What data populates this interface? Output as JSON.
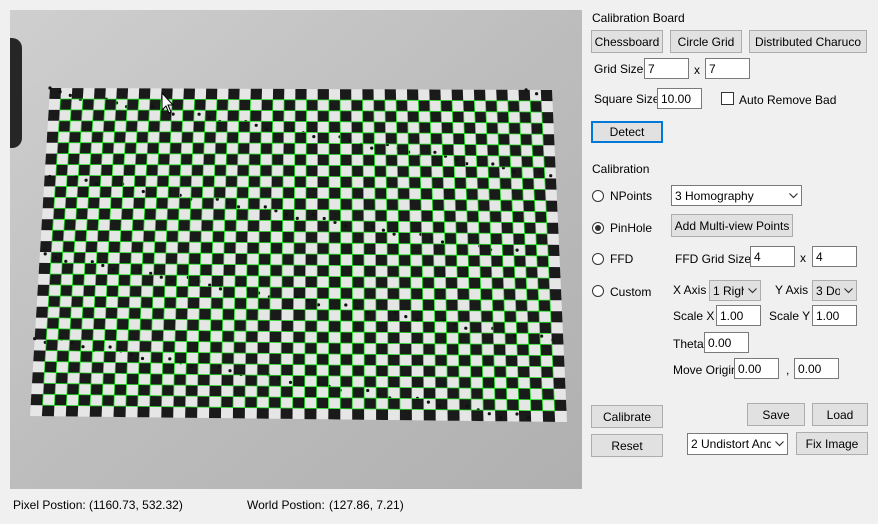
{
  "board": {
    "section_label": "Calibration Board",
    "chessboard_button": "Chessboard",
    "circle_grid_button": "Circle Grid",
    "charuco_button": "Distributed Charuco",
    "grid_size_label": "Grid Size",
    "grid_size_x": "7",
    "grid_size_sep": "x",
    "grid_size_y": "7",
    "square_size_label": "Square Size",
    "square_size_value": "10.00",
    "auto_remove_label": "Auto Remove Bad",
    "auto_remove_checked": false,
    "detect_button": "Detect"
  },
  "calibration": {
    "section_label": "Calibration",
    "npoints_label": "NPoints",
    "npoints_mode": "3 Homography",
    "pinhole_label": "PinHole",
    "pinhole_selected": true,
    "add_multiview_button": "Add Multi-view Points",
    "ffd_label": "FFD",
    "ffd_grid_size_label": "FFD Grid Size",
    "ffd_grid_x": "4",
    "ffd_grid_sep": "x",
    "ffd_grid_y": "4",
    "custom_label": "Custom",
    "x_axis_label": "X Axis",
    "x_axis_value": "1 Righ",
    "y_axis_label": "Y Axis",
    "y_axis_value": "3 Do",
    "scale_x_label": "Scale X",
    "scale_x_value": "1.00",
    "scale_y_label": "Scale Y",
    "scale_y_value": "1.00",
    "theta_label": "Theta",
    "theta_value": "0.00",
    "move_origin_label": "Move Origin",
    "move_origin_x": "0.00",
    "move_origin_sep": ",",
    "move_origin_y": "0.00"
  },
  "actions": {
    "calibrate_button": "Calibrate",
    "reset_button": "Reset",
    "save_button": "Save",
    "load_button": "Load",
    "undistort_mode": "2 Undistort And",
    "fix_image_button": "Fix Image"
  },
  "status": {
    "pixel_position_label": "Pixel Postion:",
    "pixel_position_value": "(1160.73, 532.32)",
    "world_position_label": "World Postion:",
    "world_position_value": "(127.86, 7.21)"
  },
  "image": {
    "board_rows": 30,
    "board_cols": 45,
    "grid_color": "#1fdc1f"
  }
}
